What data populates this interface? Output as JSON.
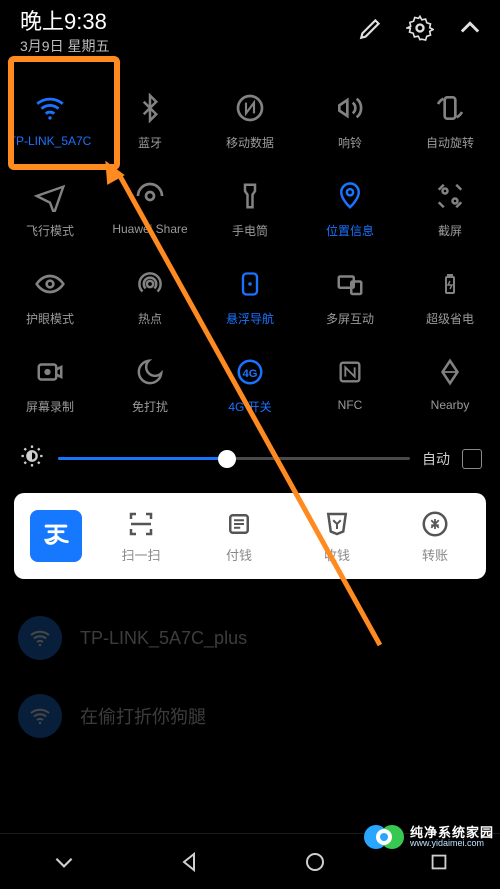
{
  "status": {
    "time": "晚上9:38",
    "date": "3月9日 星期五"
  },
  "header_icons": [
    "edit",
    "settings",
    "collapse"
  ],
  "tiles": [
    {
      "id": "wifi",
      "label": "TP-LINK_5A7C",
      "active": true
    },
    {
      "id": "bluetooth",
      "label": "蓝牙",
      "active": false
    },
    {
      "id": "mobile-data",
      "label": "移动数据",
      "active": false
    },
    {
      "id": "ring",
      "label": "响铃",
      "active": false
    },
    {
      "id": "auto-rotate",
      "label": "自动旋转",
      "active": false
    },
    {
      "id": "airplane",
      "label": "飞行模式",
      "active": false
    },
    {
      "id": "huawei-share",
      "label": "Huawei Share",
      "active": false
    },
    {
      "id": "flashlight",
      "label": "手电筒",
      "active": false
    },
    {
      "id": "location",
      "label": "位置信息",
      "active": true
    },
    {
      "id": "screenshot",
      "label": "截屏",
      "active": false
    },
    {
      "id": "eye-comfort",
      "label": "护眼模式",
      "active": false
    },
    {
      "id": "hotspot",
      "label": "热点",
      "active": false
    },
    {
      "id": "float-nav",
      "label": "悬浮导航",
      "active": true
    },
    {
      "id": "multi-screen",
      "label": "多屏互动",
      "active": false
    },
    {
      "id": "ultra-save",
      "label": "超级省电",
      "active": false
    },
    {
      "id": "screen-record",
      "label": "屏幕录制",
      "active": false
    },
    {
      "id": "dnd",
      "label": "免打扰",
      "active": false
    },
    {
      "id": "4g-switch",
      "label": "4G 开关",
      "active": true
    },
    {
      "id": "nfc",
      "label": "NFC",
      "active": false
    },
    {
      "id": "nearby",
      "label": "Nearby",
      "active": false
    }
  ],
  "brightness": {
    "percent": 48,
    "auto_label": "自动",
    "auto_checked": false
  },
  "quick_card": {
    "app": "alipay",
    "items": [
      {
        "id": "scan",
        "label": "扫一扫"
      },
      {
        "id": "pay",
        "label": "付钱"
      },
      {
        "id": "collect",
        "label": "收钱"
      },
      {
        "id": "transfer",
        "label": "转账"
      }
    ]
  },
  "wifi_list": [
    {
      "ssid": "TP-LINK_5A7C_plus"
    },
    {
      "ssid": "在偷打折你狗腿"
    }
  ],
  "annotation": {
    "highlight_tile": "wifi"
  },
  "watermark": {
    "line1": "纯净系统家园",
    "line2": "www.yidaimei.com"
  }
}
